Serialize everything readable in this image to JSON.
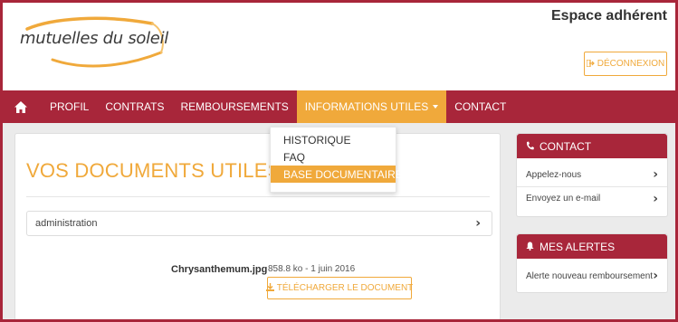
{
  "header": {
    "logo_text": "mutuelles du soleil",
    "espace_title": "Espace adhérent",
    "logout_label": "DÉCONNEXION",
    "logout_icon": "sign-out-icon"
  },
  "nav": {
    "home_icon": "home-icon",
    "items": [
      {
        "label": "PROFIL"
      },
      {
        "label": "CONTRATS"
      },
      {
        "label": "REMBOURSEMENTS"
      },
      {
        "label": "INFORMATIONS UTILES"
      },
      {
        "label": "CONTACT"
      }
    ],
    "active_index": 3
  },
  "dropdown": {
    "items": [
      {
        "label": "HISTORIQUE"
      },
      {
        "label": "FAQ"
      },
      {
        "label": "BASE DOCUMENTAIRE"
      }
    ],
    "highlighted_index": 2
  },
  "main": {
    "title": "VOS DOCUMENTS UTILES",
    "category_label": "administration",
    "document": {
      "name": "Chrysanthemum.jpg",
      "meta": "858.8 ko - 1 juin 2016",
      "download_label": "TÉLÉCHARGER LE DOCUMENT",
      "download_icon": "download-icon"
    }
  },
  "sidebar": {
    "contact": {
      "title": "CONTACT",
      "icon": "phone-icon",
      "rows": [
        {
          "label": "Appelez-nous"
        },
        {
          "label": "Envoyez un e-mail"
        }
      ]
    },
    "alerts": {
      "title": "MES ALERTES",
      "icon": "bell-icon",
      "rows": [
        {
          "label": "Alerte nouveau remboursement"
        }
      ]
    }
  },
  "colors": {
    "brand_red": "#a8263a",
    "accent_orange": "#f0a93b",
    "background_gray": "#ebebeb"
  }
}
